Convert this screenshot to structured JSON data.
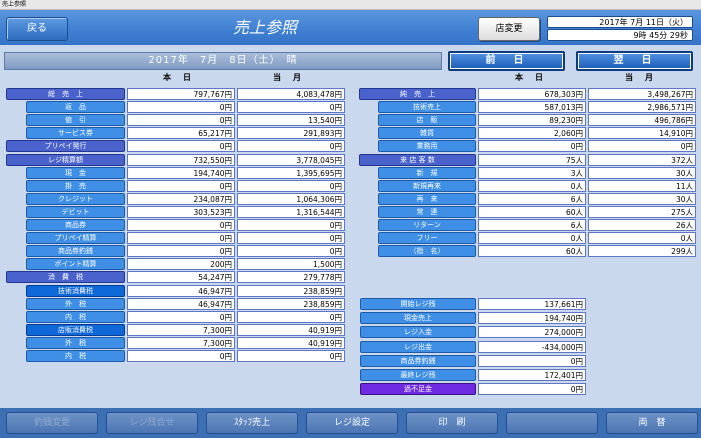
{
  "window": {
    "title": "売上参照"
  },
  "header": {
    "back_label": "戻る",
    "title": "売上参照",
    "store_change_label": "店変更",
    "clock_date": "2017年 7月 11日（火）",
    "clock_time": "9時 45分 29秒"
  },
  "date_bar": {
    "text": "2017年　7月　8日（土）　晴"
  },
  "nav": {
    "prev_label": "前　日",
    "next_label": "翌　日"
  },
  "columns": {
    "today": "本　日",
    "month": "当　月"
  },
  "left_rows": [
    {
      "label": "総　売　上",
      "style": "main",
      "today": "797,767円",
      "month": "4,083,478円"
    },
    {
      "label": "返　品",
      "style": "sub",
      "today": "0円",
      "month": "0円"
    },
    {
      "label": "値　引",
      "style": "sub",
      "today": "0円",
      "month": "13,540円"
    },
    {
      "label": "サービス券",
      "style": "sub",
      "today": "65,217円",
      "month": "291,893円"
    },
    {
      "label": "プリペイ発行",
      "style": "main",
      "today": "0円",
      "month": "0円"
    },
    {
      "label": "レジ精算額",
      "style": "main",
      "today": "732,550円",
      "month": "3,778,045円"
    },
    {
      "label": "現　金",
      "style": "sub",
      "today": "194,740円",
      "month": "1,395,695円"
    },
    {
      "label": "掛　売",
      "style": "sub",
      "today": "0円",
      "month": "0円"
    },
    {
      "label": "クレジット",
      "style": "sub",
      "today": "234,087円",
      "month": "1,064,306円"
    },
    {
      "label": "デビット",
      "style": "sub",
      "today": "303,523円",
      "month": "1,316,544円"
    },
    {
      "label": "商品券",
      "style": "sub",
      "today": "0円",
      "month": "0円"
    },
    {
      "label": "プリペイ精算",
      "style": "sub",
      "today": "0円",
      "month": "0円"
    },
    {
      "label": "商品券釣銭",
      "style": "sub",
      "today": "0円",
      "month": "0円"
    },
    {
      "label": "ポイント精算",
      "style": "sub",
      "today": "200円",
      "month": "1,500円"
    },
    {
      "label": "消　費　税",
      "style": "main",
      "today": "54,247円",
      "month": "279,778円"
    },
    {
      "label": "技術消費税",
      "style": "acc",
      "today": "46,947円",
      "month": "238,859円"
    },
    {
      "label": "外　税",
      "style": "sub",
      "today": "46,947円",
      "month": "238,859円"
    },
    {
      "label": "内　税",
      "style": "sub",
      "today": "0円",
      "month": "0円"
    },
    {
      "label": "店販消費税",
      "style": "acc",
      "today": "7,300円",
      "month": "40,919円"
    },
    {
      "label": "外　税",
      "style": "sub",
      "today": "7,300円",
      "month": "40,919円"
    },
    {
      "label": "内　税",
      "style": "sub",
      "today": "0円",
      "month": "0円"
    }
  ],
  "right_rows": [
    {
      "label": "純　売　上",
      "style": "main",
      "today": "678,303円",
      "month": "3,498,267円"
    },
    {
      "label": "技術売上",
      "style": "sub",
      "today": "587,013円",
      "month": "2,986,571円"
    },
    {
      "label": "店　販",
      "style": "sub",
      "today": "89,230円",
      "month": "496,786円"
    },
    {
      "label": "雑貨",
      "style": "sub",
      "today": "2,060円",
      "month": "14,910円"
    },
    {
      "label": "業務用",
      "style": "sub",
      "today": "0円",
      "month": "0円"
    },
    {
      "label": "来 店 客 数",
      "style": "main",
      "today": "75人",
      "month": "372人"
    },
    {
      "label": "新　規",
      "style": "sub",
      "today": "3人",
      "month": "30人"
    },
    {
      "label": "新規再来",
      "style": "sub",
      "today": "0人",
      "month": "11人"
    },
    {
      "label": "再　来",
      "style": "sub",
      "today": "6人",
      "month": "30人"
    },
    {
      "label": "常　連",
      "style": "sub",
      "today": "60人",
      "month": "275人"
    },
    {
      "label": "リターン",
      "style": "sub",
      "today": "6人",
      "month": "26人"
    },
    {
      "label": "フリー",
      "style": "sub",
      "today": "0人",
      "month": "0人"
    },
    {
      "label": "（指　名）",
      "style": "sub",
      "today": "60人",
      "month": "299人"
    }
  ],
  "register_rows": [
    {
      "label": "開始レジ残",
      "style": "sub",
      "value": "137,661円"
    },
    {
      "label": "現金売上",
      "style": "sub",
      "value": "194,740円"
    },
    {
      "label": "レジ入金",
      "style": "sub",
      "value": "274,000円"
    },
    {
      "label": "レジ出金",
      "style": "sub",
      "value": "-434,000円"
    },
    {
      "label": "商品券釣銭",
      "style": "sub",
      "value": "0円"
    },
    {
      "label": "最終レジ残",
      "style": "sub",
      "value": "172,401円"
    },
    {
      "label": "過不足金",
      "style": "pk",
      "value": "0円"
    }
  ],
  "footer": [
    {
      "label": "釣銭変更",
      "enabled": false
    },
    {
      "label": "レジ残合せ",
      "enabled": false
    },
    {
      "label": "ｽﾀｯﾌ売上",
      "enabled": true
    },
    {
      "label": "レジ設定",
      "enabled": true
    },
    {
      "label": "印　刷",
      "enabled": true
    },
    {
      "label": "",
      "enabled": true
    },
    {
      "label": "両　替",
      "enabled": true
    }
  ]
}
